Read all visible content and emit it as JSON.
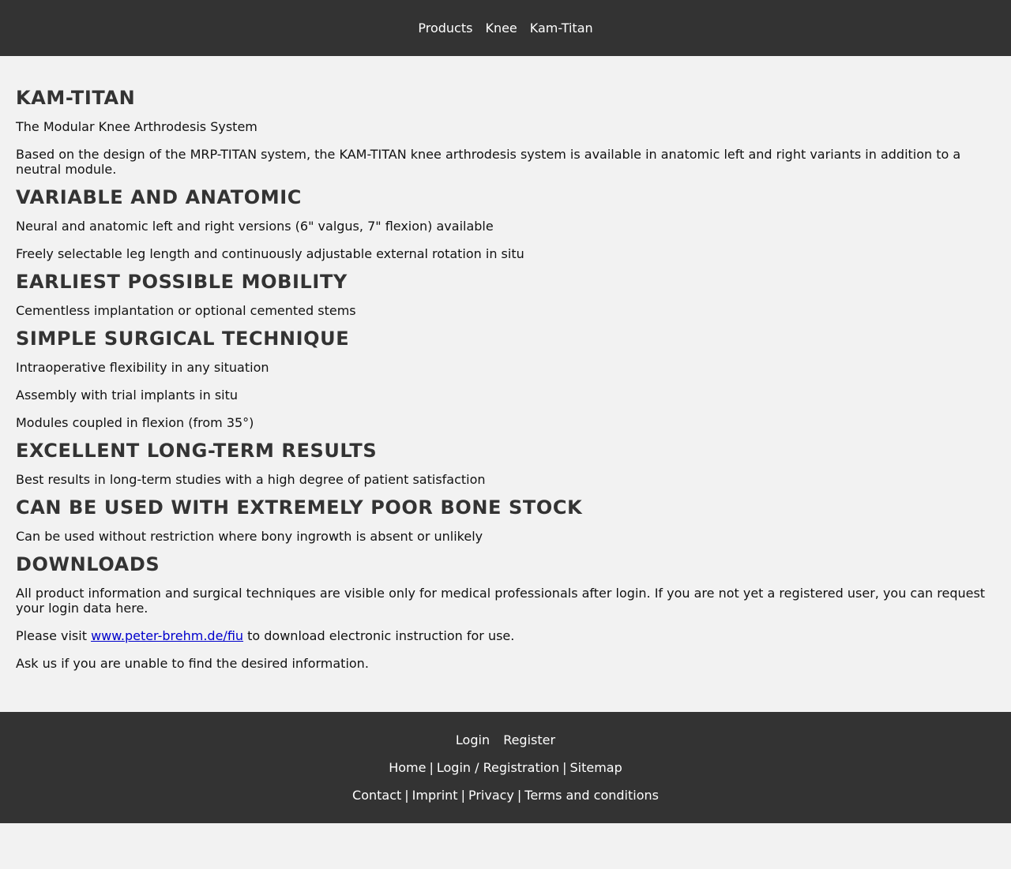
{
  "breadcrumb": [
    "Products",
    "Knee",
    "Kam-Titan"
  ],
  "content": {
    "title": "KAM-TITAN",
    "subtitle": "The Modular Knee Arthrodesis System",
    "intro": "Based on the design of the MRP-TITAN system, the KAM-TITAN knee arthrodesis system is available in anatomic left and right variants in addition to a neutral module.",
    "sections": [
      {
        "heading": "VARIABLE AND ANATOMIC",
        "items": [
          "Neural and anatomic left and right versions (6\" valgus, 7\" flexion) available",
          "Freely selectable leg length and continuously adjustable external rotation in situ"
        ]
      },
      {
        "heading": "EARLIEST POSSIBLE MOBILITY",
        "items": [
          "Cementless implantation or optional cemented stems"
        ]
      },
      {
        "heading": "SIMPLE SURGICAL TECHNIQUE",
        "items": [
          "Intraoperative flexibility in any situation",
          "Assembly with trial implants in situ",
          "Modules coupled in flexion (from 35°)"
        ]
      },
      {
        "heading": "EXCELLENT LONG-TERM RESULTS",
        "items": [
          "Best results in long-term studies with a high degree of patient satisfaction"
        ]
      },
      {
        "heading": "CAN BE USED WITH EXTREMELY POOR BONE STOCK",
        "items": [
          "Can be used without restriction where bony ingrowth is absent or unlikely"
        ]
      }
    ],
    "downloads": {
      "heading": "DOWNLOADS",
      "info": "All product information and surgical techniques are visible only for medical professionals after login. If you are not yet a registered user, you can request your login data here.",
      "visit_prefix": "Please visit ",
      "visit_link": "www.peter-brehm.de/fiu",
      "visit_suffix": " to download electronic instruction for use.",
      "ask": "Ask us if you are unable to find the desired information."
    }
  },
  "footer": {
    "row1": [
      "Login",
      "Register"
    ],
    "row2": [
      "Home",
      "Login / Registration",
      "Sitemap"
    ],
    "row3": [
      "Contact",
      "Imprint",
      "Privacy",
      "Terms and conditions"
    ],
    "separator": "|"
  },
  "colors": {
    "bar": "#333333",
    "background": "#f2f2f2",
    "link": "#0000cc"
  }
}
